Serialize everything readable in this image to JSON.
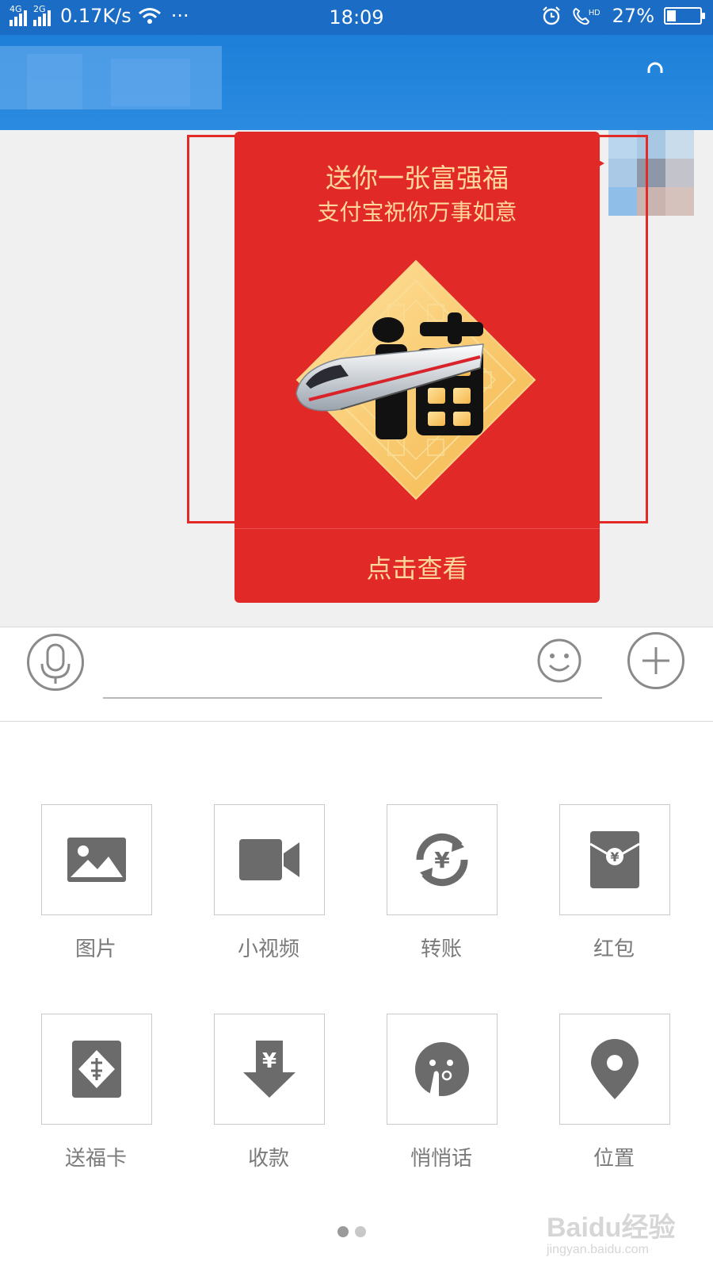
{
  "status_bar": {
    "net1": "4G",
    "net2": "2G",
    "speed": "0.17K/s",
    "more": "···",
    "time": "18:09",
    "battery": "27%",
    "battery_level": 0.27
  },
  "card": {
    "title": "送你一张富强福",
    "subtitle": "支付宝祝你万事如意",
    "action": "点击查看",
    "colors": {
      "background": "#e12a28",
      "text": "#ffd79a",
      "highlight": "#e22a26"
    }
  },
  "input_bar": {
    "voice_icon": "microphone-icon",
    "emoji_icon": "smiley-icon",
    "add_icon": "plus-icon"
  },
  "panel": {
    "row1": [
      {
        "label": "图片",
        "icon": "image-icon"
      },
      {
        "label": "小视频",
        "icon": "video-camera-icon"
      },
      {
        "label": "转账",
        "icon": "transfer-icon"
      },
      {
        "label": "红包",
        "icon": "red-envelope-icon"
      }
    ],
    "row2": [
      {
        "label": "送福卡",
        "icon": "fu-card-icon"
      },
      {
        "label": "收款",
        "icon": "receive-money-icon"
      },
      {
        "label": "悄悄话",
        "icon": "whisper-icon"
      },
      {
        "label": "位置",
        "icon": "location-pin-icon"
      }
    ],
    "page_count": 2,
    "current_page": 1
  },
  "watermark": {
    "brand": "Baidu经验",
    "url": "jingyan.baidu.com"
  }
}
